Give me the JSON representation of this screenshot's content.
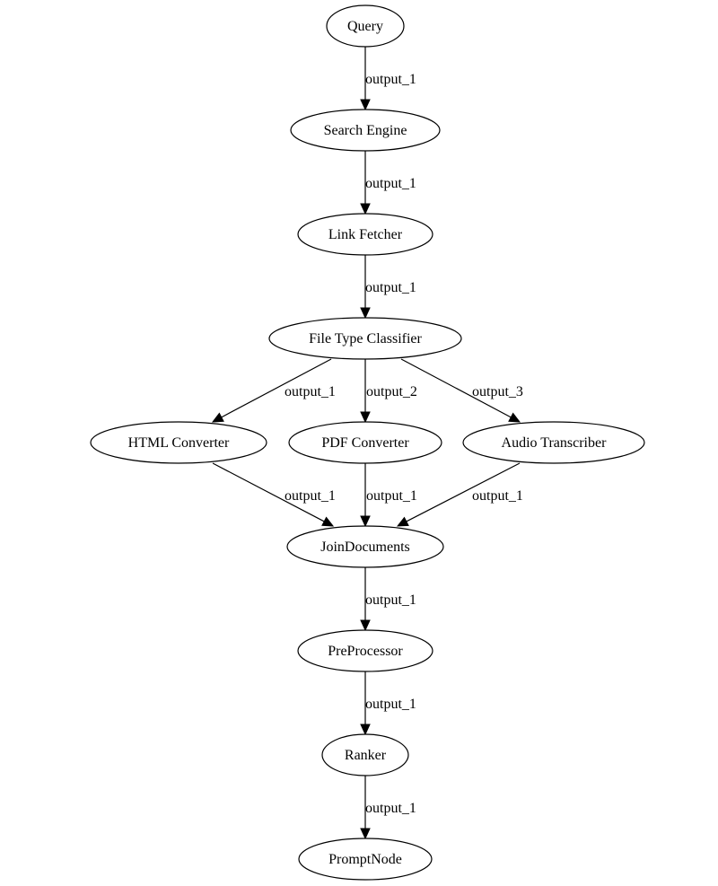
{
  "diagram": {
    "type": "pipeline-graph",
    "nodes": [
      {
        "id": "query",
        "label": "Query"
      },
      {
        "id": "search_engine",
        "label": "Search Engine"
      },
      {
        "id": "link_fetcher",
        "label": "Link Fetcher"
      },
      {
        "id": "file_type_classifier",
        "label": "File Type Classifier"
      },
      {
        "id": "html_converter",
        "label": "HTML Converter"
      },
      {
        "id": "pdf_converter",
        "label": "PDF Converter"
      },
      {
        "id": "audio_transcriber",
        "label": "Audio Transcriber"
      },
      {
        "id": "join_documents",
        "label": "JoinDocuments"
      },
      {
        "id": "preprocessor",
        "label": "PreProcessor"
      },
      {
        "id": "ranker",
        "label": "Ranker"
      },
      {
        "id": "prompt_node",
        "label": "PromptNode"
      }
    ],
    "edges": [
      {
        "from": "query",
        "to": "search_engine",
        "label": "output_1"
      },
      {
        "from": "search_engine",
        "to": "link_fetcher",
        "label": "output_1"
      },
      {
        "from": "link_fetcher",
        "to": "file_type_classifier",
        "label": "output_1"
      },
      {
        "from": "file_type_classifier",
        "to": "html_converter",
        "label": "output_1"
      },
      {
        "from": "file_type_classifier",
        "to": "pdf_converter",
        "label": "output_2"
      },
      {
        "from": "file_type_classifier",
        "to": "audio_transcriber",
        "label": "output_3"
      },
      {
        "from": "html_converter",
        "to": "join_documents",
        "label": "output_1"
      },
      {
        "from": "pdf_converter",
        "to": "join_documents",
        "label": "output_1"
      },
      {
        "from": "audio_transcriber",
        "to": "join_documents",
        "label": "output_1"
      },
      {
        "from": "join_documents",
        "to": "preprocessor",
        "label": "output_1"
      },
      {
        "from": "preprocessor",
        "to": "ranker",
        "label": "output_1"
      },
      {
        "from": "ranker",
        "to": "prompt_node",
        "label": "output_1"
      }
    ]
  }
}
